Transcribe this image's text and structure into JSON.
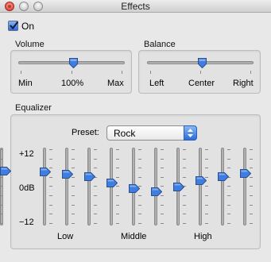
{
  "window": {
    "title": "Effects"
  },
  "on_checkbox": {
    "label": "On",
    "checked": true
  },
  "volume": {
    "title": "Volume",
    "min_label": "Min",
    "value_label": "100%",
    "max_label": "Max",
    "level": 0.5
  },
  "balance": {
    "title": "Balance",
    "left_label": "Left",
    "center_label": "Center",
    "right_label": "Right",
    "level": 0.5
  },
  "equalizer": {
    "title": "Equalizer",
    "preset_label": "Preset:",
    "preset_value": "Rock",
    "scale_top": "+12",
    "scale_mid": "0dB",
    "scale_bottom": "−12",
    "group_low": "Low",
    "group_middle": "Middle",
    "group_high": "High",
    "preamp_level": 0.31,
    "band_levels": [
      0.34,
      0.37,
      0.45,
      0.52,
      0.56,
      0.5,
      0.42,
      0.37,
      0.33,
      0.3
    ]
  },
  "colors": {
    "accent": "#2c6bd9",
    "close_button": "#d8322a"
  }
}
